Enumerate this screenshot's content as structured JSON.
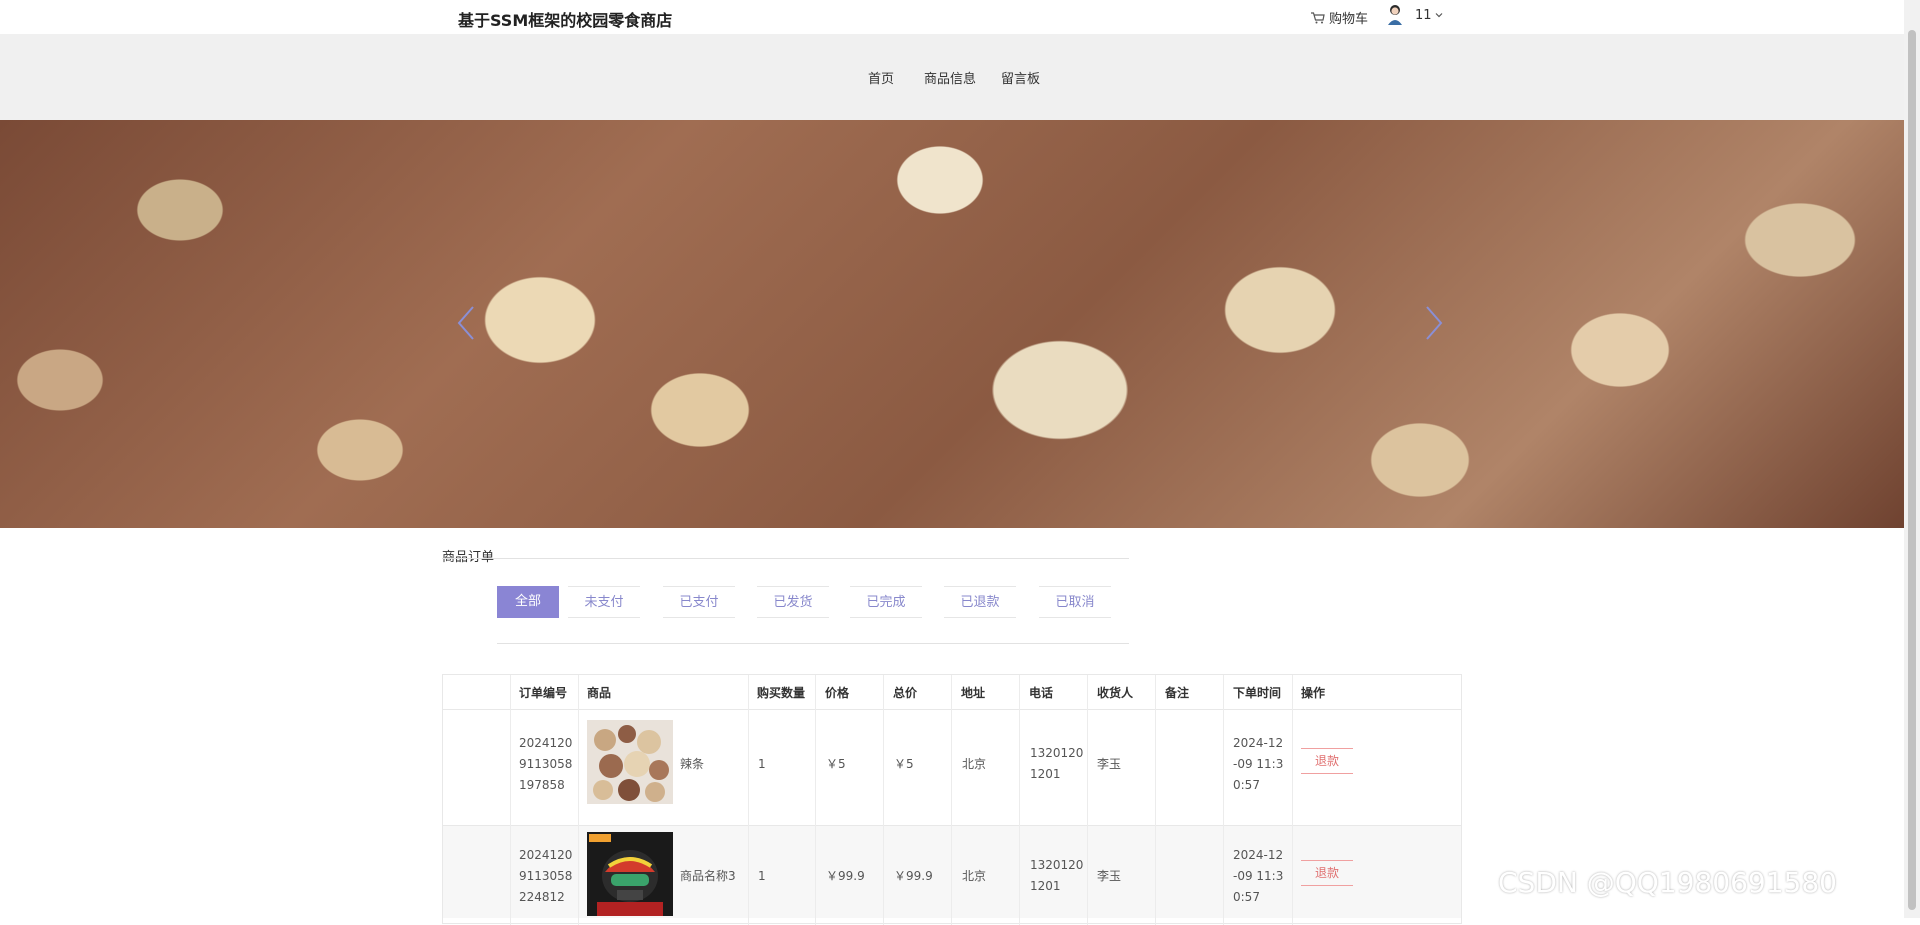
{
  "header": {
    "brand": "基于SSM框架的校园零食商店",
    "cart_label": "购物车",
    "username": "11"
  },
  "nav": {
    "items": [
      "首页",
      "商品信息",
      "留言板"
    ]
  },
  "orders": {
    "section_title": "商品订单",
    "tabs": [
      "全部",
      "未支付",
      "已支付",
      "已发货",
      "已完成",
      "已退款",
      "已取消"
    ],
    "active_tab": "全部",
    "columns": [
      "订单编号",
      "商品",
      "购买数量",
      "价格",
      "总价",
      "地址",
      "电话",
      "收货人",
      "备注",
      "下单时间",
      "操作"
    ],
    "rows": [
      {
        "order_no_lines": [
          "2024120",
          "9113058",
          "197858"
        ],
        "product_name": "辣条",
        "quantity": "1",
        "price": "￥5",
        "total": "￥5",
        "address": "北京",
        "phone_lines": [
          "1320120",
          "1201"
        ],
        "receiver": "李玉",
        "note": "",
        "time_lines": [
          "2024-12",
          "-09 11:3",
          "0:57"
        ],
        "action": "退款"
      },
      {
        "order_no_lines": [
          "2024120",
          "9113058",
          "224812"
        ],
        "product_name": "商品名称3",
        "quantity": "1",
        "price": "￥99.9",
        "total": "￥99.9",
        "address": "北京",
        "phone_lines": [
          "1320120",
          "1201"
        ],
        "receiver": "李玉",
        "note": "",
        "time_lines": [
          "2024-12",
          "-09 11:3",
          "0:57"
        ],
        "action": "退款"
      }
    ]
  },
  "watermark": "CSDN @QQ1980691580",
  "colors": {
    "accent": "#8a85d4",
    "refund": "#e07070",
    "nav_bg": "#f0f0f0"
  }
}
